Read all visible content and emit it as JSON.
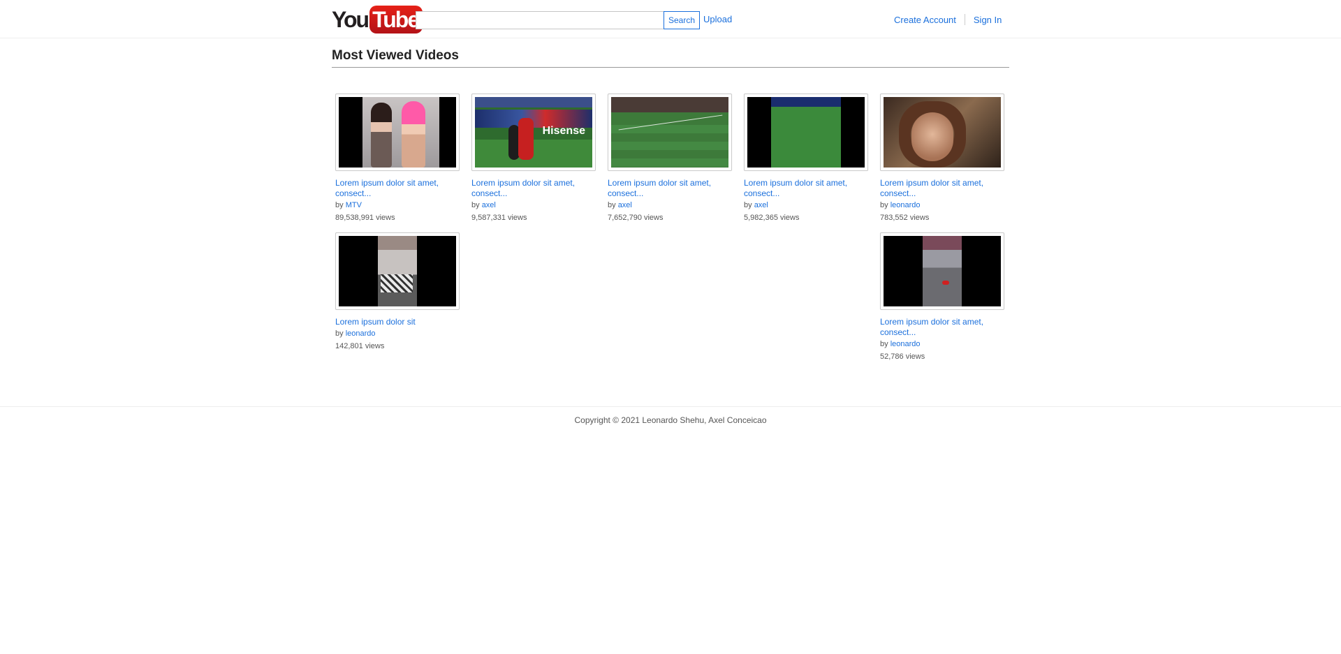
{
  "header": {
    "logo_you": "You",
    "logo_tube": "Tube",
    "search": {
      "placeholder": "",
      "value": "",
      "button_label": "Search"
    },
    "upload_label": "Upload",
    "create_account_label": "Create Account",
    "sign_in_label": "Sign In"
  },
  "main": {
    "title": "Most Viewed Videos",
    "videos": [
      {
        "title": "Lorem ipsum dolor sit amet, consect...",
        "by_prefix": "by",
        "author": "MTV",
        "views": "89,538,991 views"
      },
      {
        "title": "Lorem ipsum dolor sit amet, consect...",
        "by_prefix": "by",
        "author": "axel",
        "views": "9,587,331 views"
      },
      {
        "title": "Lorem ipsum dolor sit amet, consect...",
        "by_prefix": "by",
        "author": "axel",
        "views": "7,652,790 views"
      },
      {
        "title": "Lorem ipsum dolor sit amet, consect...",
        "by_prefix": "by",
        "author": "axel",
        "views": "5,982,365 views"
      },
      {
        "title": "Lorem ipsum dolor sit amet, consect...",
        "by_prefix": "by",
        "author": "leonardo",
        "views": "783,552 views"
      },
      {
        "title": "Lorem ipsum dolor sit",
        "by_prefix": "by",
        "author": "leonardo",
        "views": "142,801 views"
      },
      {
        "title": "Lorem ipsum dolor sit amet, consect...",
        "by_prefix": "by",
        "author": "leonardo",
        "views": "52,786 views"
      }
    ],
    "thumb_texts": {
      "ad_text": "Hisense"
    }
  },
  "footer": {
    "copyright": "Copyright © 2021 Leonardo Shehu, Axel Conceicao"
  },
  "colors": {
    "link": "#1a6fdc",
    "logo_red": "#e62117",
    "text_gray": "#555555",
    "divider": "#999999"
  }
}
